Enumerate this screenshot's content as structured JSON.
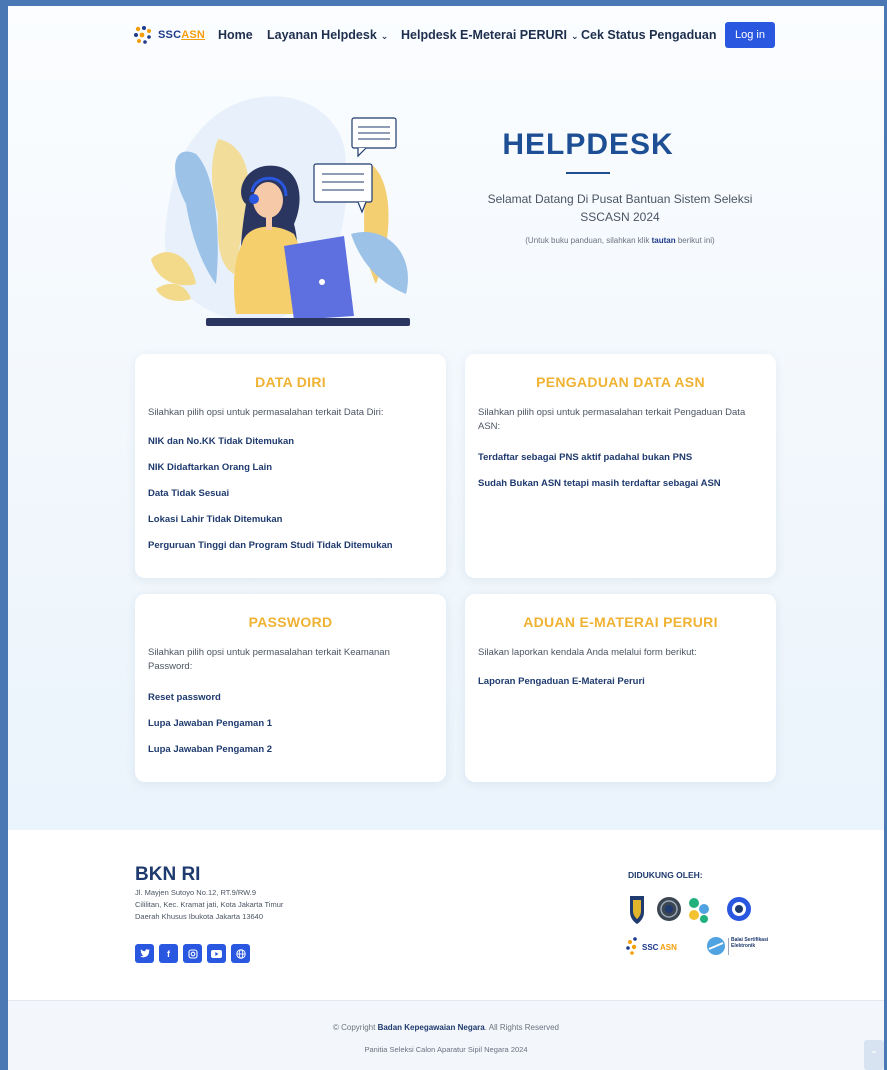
{
  "header": {
    "logo_text_a": "SSC",
    "logo_text_b": "ASN",
    "nav": [
      {
        "label": "Home"
      },
      {
        "label": "Layanan Helpdesk",
        "dropdown": true
      },
      {
        "label": "Helpdesk E-Meterai PERURI",
        "dropdown": true
      },
      {
        "label": "Cek Status Pengaduan"
      }
    ],
    "login_label": "Log in"
  },
  "hero": {
    "title": "HELPDESK",
    "subtitle": "Selamat Datang Di Pusat Bantuan Sistem Seleksi SSCASN 2024",
    "note_prefix": "(Untuk buku panduan, silahkan klik",
    "note_link": "tautan",
    "note_suffix": "berikut ini)"
  },
  "cards": {
    "data_diri": {
      "title": "DATA DIRI",
      "desc": "Silahkan pilih opsi untuk permasalahan terkait Data Diri:",
      "links": [
        "NIK dan No.KK Tidak Ditemukan",
        "NIK Didaftarkan Orang Lain",
        "Data Tidak Sesuai",
        "Lokasi Lahir Tidak Ditemukan",
        "Perguruan Tinggi dan Program Studi Tidak Ditemukan"
      ]
    },
    "pengaduan": {
      "title": "PENGADUAN DATA ASN",
      "desc": "Silahkan pilih opsi untuk permasalahan terkait Pengaduan Data ASN:",
      "links": [
        "Terdaftar sebagai PNS aktif padahal bukan PNS",
        "Sudah Bukan ASN tetapi masih terdaftar sebagai ASN"
      ]
    },
    "password": {
      "title": "PASSWORD",
      "desc": "Silahkan pilih opsi untuk permasalahan terkait Keamanan Password:",
      "links": [
        "Reset password",
        "Lupa Jawaban Pengaman 1",
        "Lupa Jawaban Pengaman 2"
      ]
    },
    "aduan": {
      "title": "ADUAN E-MATERAI PERURI",
      "desc": "Silakan laporkan kendala Anda melalui form berikut:",
      "links": [
        "Laporan Pengaduan E-Materai Peruri"
      ]
    }
  },
  "footer": {
    "title": "BKN RI",
    "address": [
      "Jl. Mayjen Sutoyo No.12, RT.9/RW.9",
      "Cililitan, Kec. Kramat jati, Kota Jakarta Timur",
      "Daerah Khusus Ibukota Jakarta 13640"
    ],
    "socials": [
      "twitter-icon",
      "facebook-icon",
      "instagram-icon",
      "youtube-icon",
      "globe-icon"
    ],
    "supported_title": "DIDUKUNG OLEH:",
    "bsre_text": "Balai Sertifikasi Elektronik"
  },
  "bottom": {
    "copy_prefix": "© Copyright",
    "copy_org": "Badan Kepegawaian Negara",
    "copy_suffix": ". All Rights Reserved",
    "line2": "Panitia Seleksi Calon Aparatur Sipil Negara 2024"
  },
  "colors": {
    "primary": "#2a57e0",
    "title_blue": "#1e4f94",
    "card_title": "#f0b232"
  }
}
